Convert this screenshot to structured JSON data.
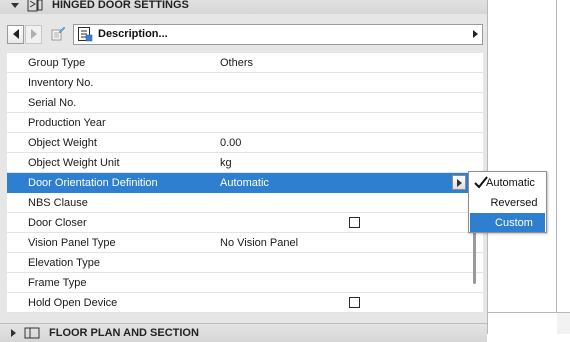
{
  "section_top": {
    "title": "HINGED DOOR SETTINGS",
    "icon": "hinged-door-settings-icon"
  },
  "toolbar": {
    "prev_icon": "arrow-left-icon",
    "next_icon": "arrow-right-icon",
    "edit_icon": "edit-parameters-icon",
    "dropdown_label": "Description...",
    "dropdown_icon": "description-list-icon"
  },
  "parameters": [
    {
      "name": "Group Type",
      "value": "Others",
      "checkbox": false
    },
    {
      "name": "Inventory No.",
      "value": "",
      "checkbox": false
    },
    {
      "name": "Serial No.",
      "value": "",
      "checkbox": false
    },
    {
      "name": "Production Year",
      "value": "",
      "checkbox": false
    },
    {
      "name": "Object Weight",
      "value": "0.00",
      "checkbox": false
    },
    {
      "name": "Object Weight Unit",
      "value": "kg",
      "checkbox": false
    },
    {
      "name": "Door Orientation Definition",
      "value": "Automatic",
      "checkbox": false,
      "selected": true
    },
    {
      "name": "NBS Clause",
      "value": "",
      "checkbox": false
    },
    {
      "name": "Door Closer",
      "value": "",
      "checkbox": true,
      "checked": false
    },
    {
      "name": "Vision Panel Type",
      "value": "No Vision Panel",
      "checkbox": false
    },
    {
      "name": "Elevation Type",
      "value": "",
      "checkbox": false
    },
    {
      "name": "Frame Type",
      "value": "",
      "checkbox": false
    },
    {
      "name": "Hold Open Device",
      "value": "",
      "checkbox": true,
      "checked": false
    }
  ],
  "popup": {
    "options": [
      {
        "label": "Automatic",
        "checked": true
      },
      {
        "label": "Reversed",
        "checked": false
      },
      {
        "label": "Custom",
        "highlighted": true
      }
    ]
  },
  "section_bottom": {
    "title": "FLOOR PLAN AND SECTION",
    "icon": "floor-plan-section-icon"
  },
  "colors": {
    "selection": "#2f7fd1",
    "panel_bg": "#e6e6e6"
  }
}
